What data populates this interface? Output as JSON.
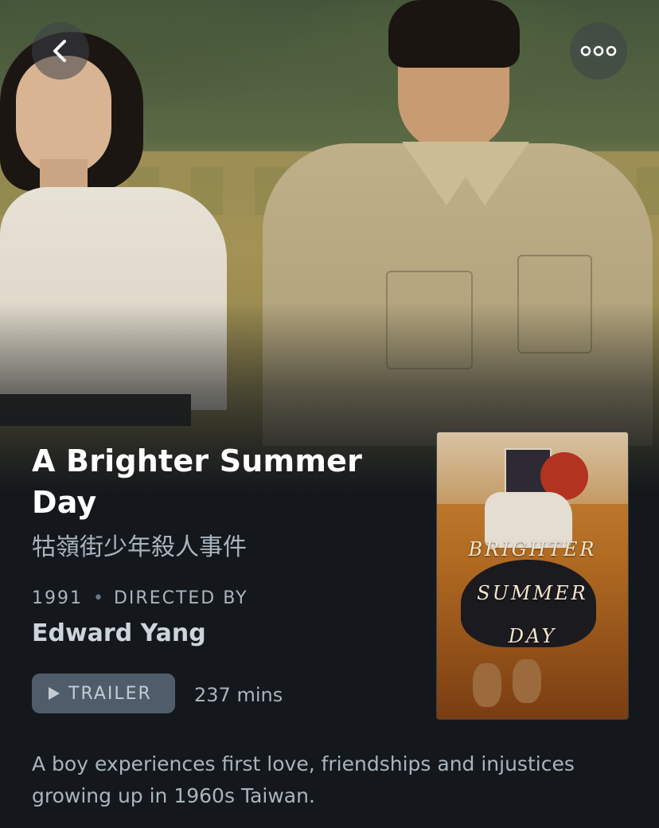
{
  "nav": {
    "back_icon": "chevron-left-icon",
    "more_icon": "more-horizontal-icon"
  },
  "film": {
    "title": "A Brighter Summer Day",
    "original_title": "牯嶺街少年殺人事件",
    "year": "1991",
    "separator": "•",
    "directed_by_label": "DIRECTED BY",
    "director": "Edward Yang",
    "trailer_label": "TRAILER",
    "runtime": "237 mins",
    "synopsis": "A boy experiences first love, friendships and injustices growing up in 1960s Taiwan."
  },
  "poster": {
    "lines": [
      "BRIGHTER",
      "SUMMER",
      "DAY"
    ]
  },
  "colors": {
    "background": "#14181c",
    "title": "#ffffff",
    "secondary_text": "#a9b4bf",
    "trailer_button": "#4f5d6a"
  }
}
